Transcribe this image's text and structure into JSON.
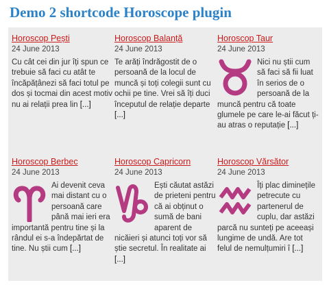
{
  "page": {
    "title": "Demo 2 shortcode Horoscope plugin"
  },
  "colors": {
    "title": "#2b82c8",
    "link": "#cc1a1a",
    "sign": "#b43a82",
    "panel": "#ececec"
  },
  "cards": [
    {
      "title": "Horoscop Pești",
      "date": "24 June 2013",
      "icon": "pisces-icon",
      "text": "Cu cât cei din jur îți spun ce trebuie să faci cu atât te încăpățânezi să faci totul pe dos și tocmai din acest motiv nu ai relații prea lin",
      "more": "[...]"
    },
    {
      "title": "Horoscop Balanță",
      "date": "24 June 2013",
      "icon": "libra-icon",
      "text": "Te arăți îndrăgostit de o persoană de la locul de muncă și toți colegii sunt cu ochii pe tine. Vrei să îți duci începutul de relație departe",
      "more": "[...]"
    },
    {
      "title": "Horoscop Taur",
      "date": "24 June 2013",
      "icon": "taurus-icon",
      "text": "Nici nu știi cum să faci să fii luat în serios de o persoană de la muncă pentru că toate glumele pe care le-ai făcut ți-au atras o reputație",
      "more": "[...]"
    },
    {
      "title": "Horoscop Berbec",
      "date": "24 June 2013",
      "icon": "aries-icon",
      "text": "Ai devenit ceva mai distant cu o persoană care până mai ieri era importantă pentru tine și la rândul ei s-a îndepărtat de tine. Nu știi cum",
      "more": "[...]"
    },
    {
      "title": "Horoscop Capricorn",
      "date": "24 June 2013",
      "icon": "capricorn-icon",
      "text": "Ești căutat astăzi de prieteni pentru că ai obținut o sumă de bani aparent de nicăieri și atunci toți vor să știe secretul. În realitate ai",
      "more": "[...]"
    },
    {
      "title": "Horoscop Vărsător",
      "date": "24 June 2013",
      "icon": "aquarius-icon",
      "text": "Îți plac diminețile petrecute cu partenerul de cuplu, dar astăzi parcă nu sunteți pe aceeași lungime de undă. Are tot felul de nemulțumiri î",
      "more": "[...]"
    }
  ]
}
